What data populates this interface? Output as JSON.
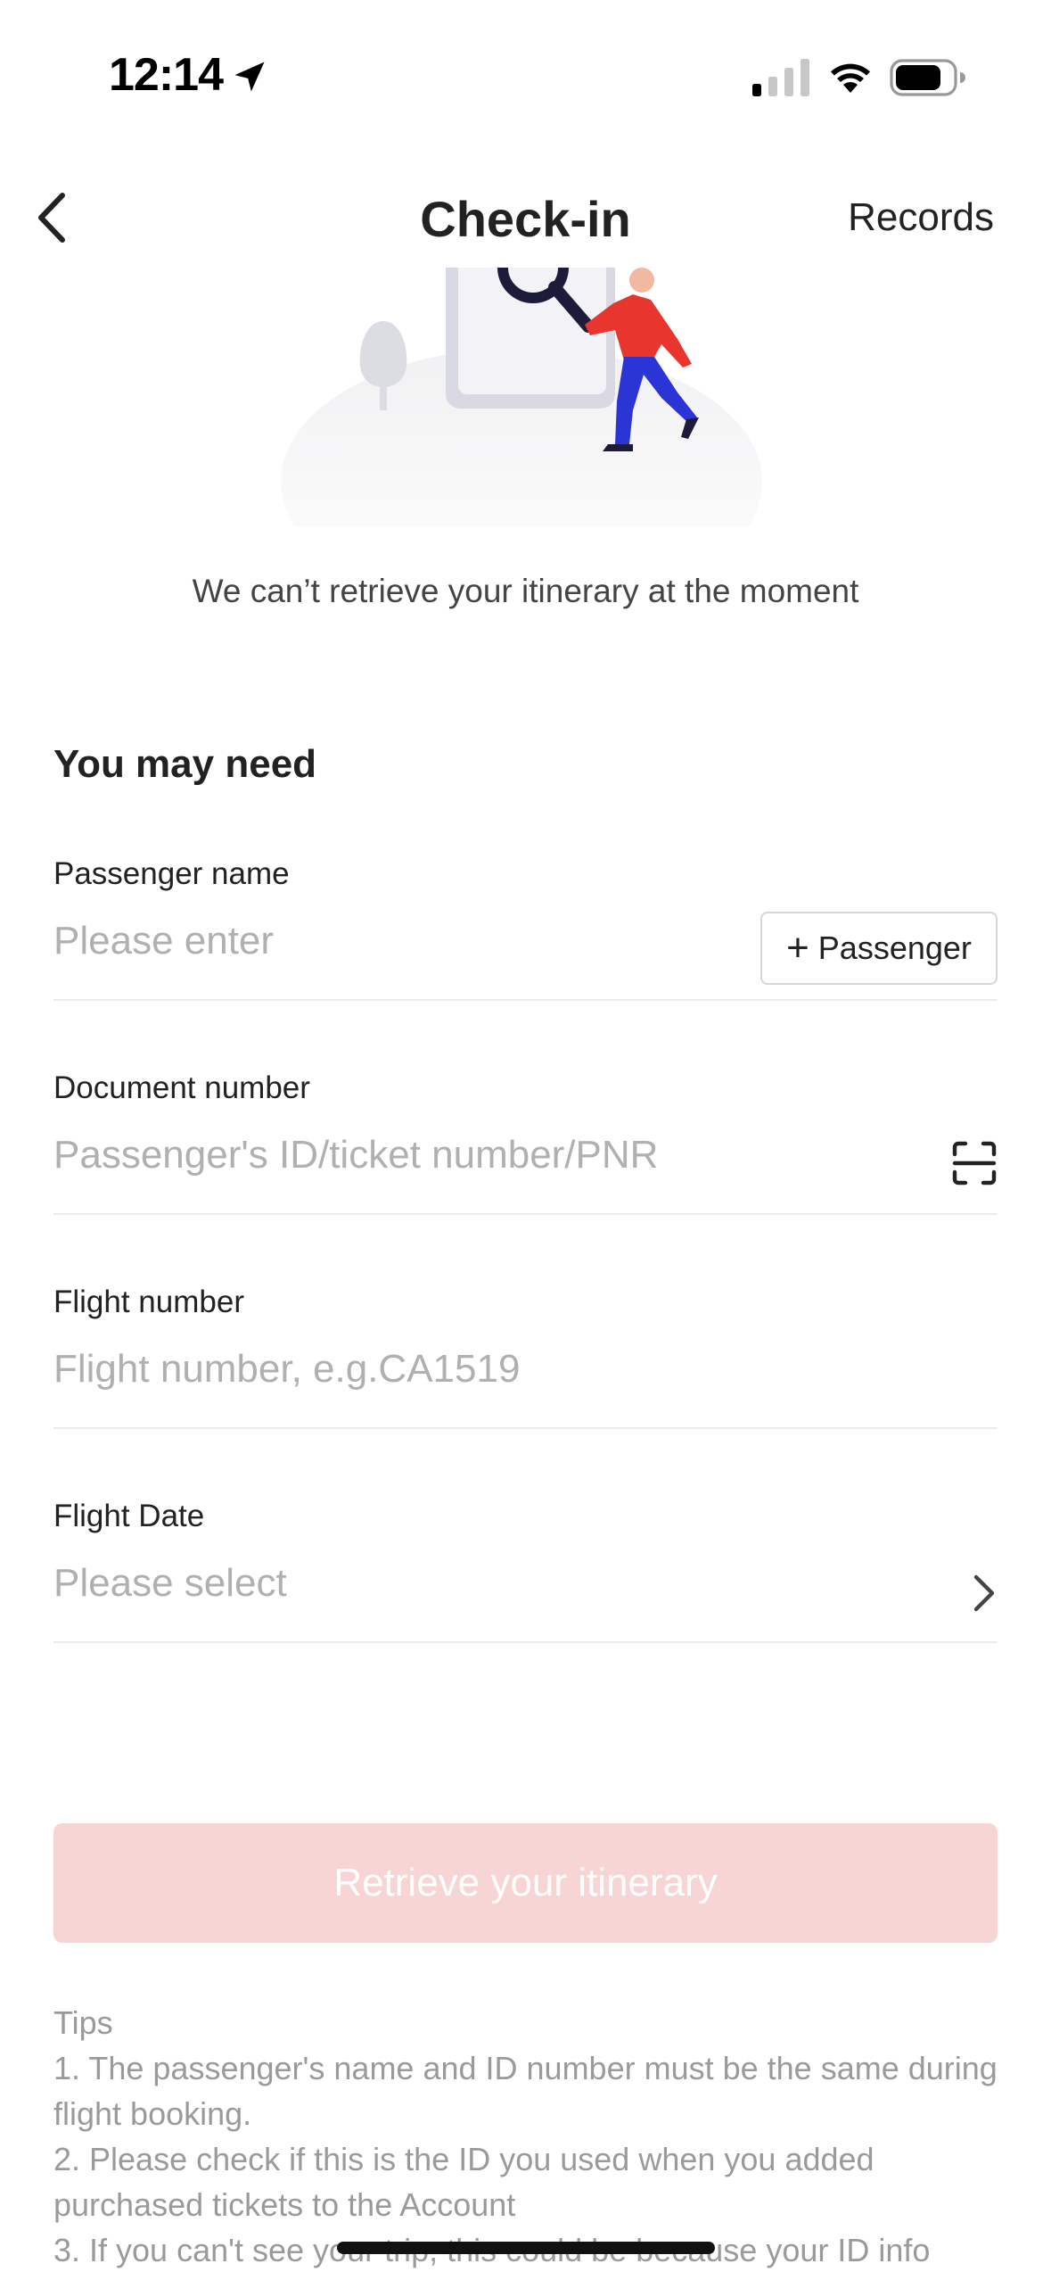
{
  "status_bar": {
    "time": "12:14",
    "icons": [
      "location-arrow-icon",
      "cellular-signal-icon",
      "wifi-icon",
      "battery-icon"
    ]
  },
  "nav": {
    "title": "Check-in",
    "records_label": "Records",
    "back_icon": "chevron-left-icon"
  },
  "illustration": {
    "icon": "searching-person-illustration"
  },
  "empty_message": "We can’t retrieve your itinerary at the moment",
  "form": {
    "section_title": "You may need",
    "passenger_name": {
      "label": "Passenger name",
      "placeholder": "Please enter",
      "add_button_label": "Passenger",
      "add_button_icon": "plus-icon"
    },
    "document_number": {
      "label": "Document number",
      "placeholder": "Passenger's ID/ticket number/PNR",
      "icon": "scan-icon"
    },
    "flight_number": {
      "label": "Flight number",
      "placeholder": "Flight number, e.g.CA1519"
    },
    "flight_date": {
      "label": "Flight Date",
      "placeholder": "Please select",
      "icon": "chevron-right-icon"
    },
    "submit_label": "Retrieve your itinerary"
  },
  "colors": {
    "submit_bg": "#f7d5d5",
    "placeholder": "#b0b0b0",
    "tips_text": "#9a9a9a",
    "accent_red": "#e8352e",
    "accent_blue": "#2b35d6"
  },
  "tips": {
    "title": "Tips",
    "items": [
      "1. The passenger's name and ID number must be the same during flight booking.",
      "2. Please check if this is the ID you used when you added purchased tickets to the Account",
      "3. If you can't see your trip, this could be because your ID info"
    ]
  }
}
